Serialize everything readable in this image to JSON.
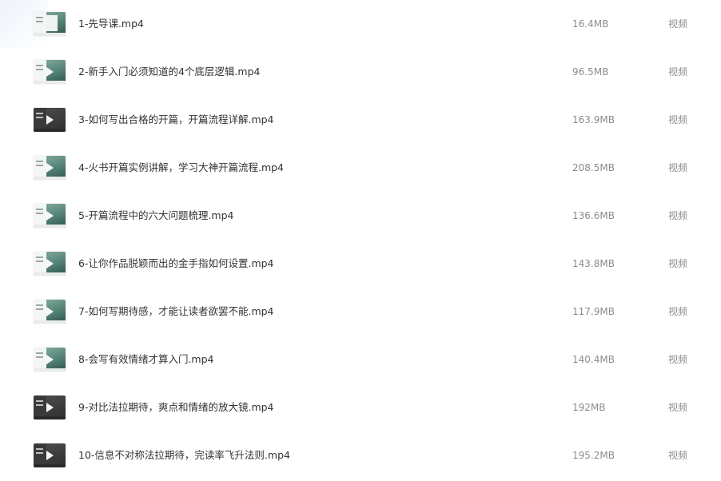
{
  "files": [
    {
      "name": "1-先导课.mp4",
      "size": "16.4MB",
      "type": "视频",
      "thumbnail_icon": "video-thumbnail-light"
    },
    {
      "name": "2-新手入门必须知道的4个底层逻辑.mp4",
      "size": "96.5MB",
      "type": "视频",
      "thumbnail_icon": "video-thumbnail-light"
    },
    {
      "name": "3-如何写出合格的开篇，开篇流程详解.mp4",
      "size": "163.9MB",
      "type": "视频",
      "thumbnail_icon": "video-thumbnail-dark"
    },
    {
      "name": "4-火书开篇实例讲解，学习大神开篇流程.mp4",
      "size": "208.5MB",
      "type": "视频",
      "thumbnail_icon": "video-thumbnail-light"
    },
    {
      "name": "5-开篇流程中的六大问题梳理.mp4",
      "size": "136.6MB",
      "type": "视频",
      "thumbnail_icon": "video-thumbnail-light"
    },
    {
      "name": "6-让你作品脱颖而出的金手指如何设置.mp4",
      "size": "143.8MB",
      "type": "视频",
      "thumbnail_icon": "video-thumbnail-light"
    },
    {
      "name": "7-如何写期待感，才能让读者欲罢不能.mp4",
      "size": "117.9MB",
      "type": "视频",
      "thumbnail_icon": "video-thumbnail-light"
    },
    {
      "name": "8-会写有效情绪才算入门.mp4",
      "size": "140.4MB",
      "type": "视频",
      "thumbnail_icon": "video-thumbnail-light"
    },
    {
      "name": "9-对比法拉期待，爽点和情绪的放大镜.mp4",
      "size": "192MB",
      "type": "视频",
      "thumbnail_icon": "video-thumbnail-dark"
    },
    {
      "name": "10-信息不对称法拉期待，完读率飞升法则.mp4",
      "size": "195.2MB",
      "type": "视频",
      "thumbnail_icon": "video-thumbnail-dark"
    }
  ]
}
